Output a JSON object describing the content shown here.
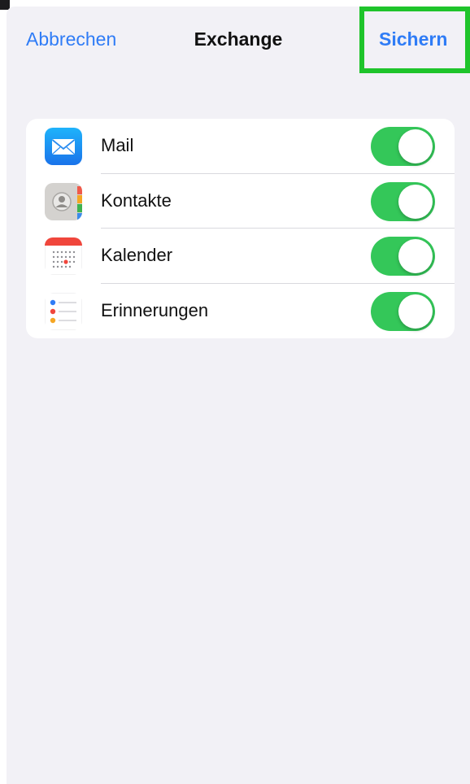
{
  "nav": {
    "cancel_label": "Abbrechen",
    "title": "Exchange",
    "save_label": "Sichern"
  },
  "accounts": {
    "items": [
      {
        "label": "Mail",
        "icon": "mail-icon",
        "enabled": true
      },
      {
        "label": "Kontakte",
        "icon": "contacts-icon",
        "enabled": true
      },
      {
        "label": "Kalender",
        "icon": "calendar-icon",
        "enabled": true
      },
      {
        "label": "Erinnerungen",
        "icon": "reminders-icon",
        "enabled": true
      }
    ]
  },
  "colors": {
    "accent": "#2f7cf6",
    "toggle_on": "#34c759",
    "highlight": "#1fc42b",
    "background": "#f2f1f6"
  }
}
